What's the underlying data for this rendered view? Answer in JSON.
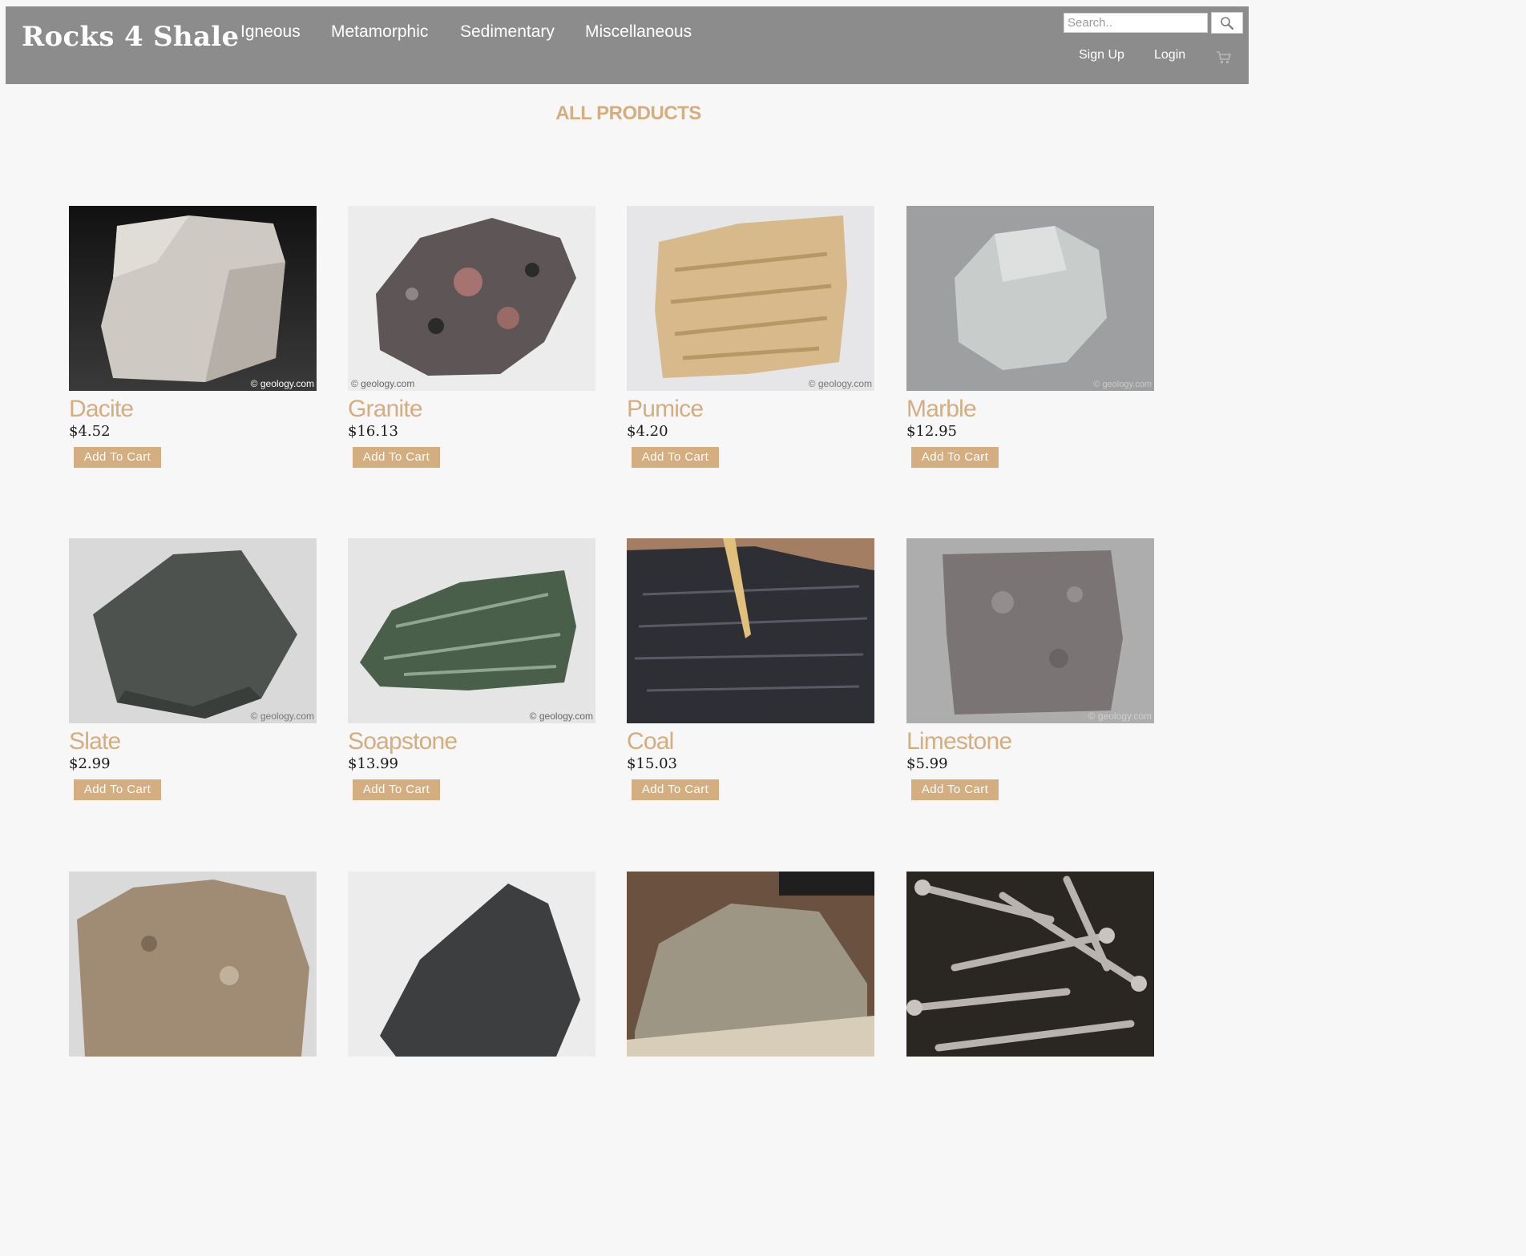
{
  "header": {
    "brand": "Rocks 4 Shale",
    "nav": [
      "Igneous",
      "Metamorphic",
      "Sedimentary",
      "Miscellaneous"
    ],
    "search_placeholder": "Search..",
    "sign_up": "Sign Up",
    "login": "Login",
    "search_icon": "magnifier-icon",
    "cart_icon": "shopping-cart-icon"
  },
  "main": {
    "title": "ALL PRODUCTS",
    "add_to_cart_label": "Add To Cart",
    "products": [
      {
        "name": "Dacite",
        "price": "$4.52",
        "watermark": "© geology.com"
      },
      {
        "name": "Granite",
        "price": "$16.13",
        "watermark": "© geology.com"
      },
      {
        "name": "Pumice",
        "price": "$4.20",
        "watermark": "© geology.com"
      },
      {
        "name": "Marble",
        "price": "$12.95",
        "watermark": "© geology.com"
      },
      {
        "name": "Slate",
        "price": "$2.99",
        "watermark": "© geology.com"
      },
      {
        "name": "Soapstone",
        "price": "$13.99",
        "watermark": "© geology.com"
      },
      {
        "name": "Coal",
        "price": "$15.03"
      },
      {
        "name": "Limestone",
        "price": "$5.99",
        "watermark": "© geology.com"
      }
    ]
  },
  "colors": {
    "navbar": "#8c8c8c",
    "accent": "#d4ad80",
    "background": "#f7f7f7"
  }
}
